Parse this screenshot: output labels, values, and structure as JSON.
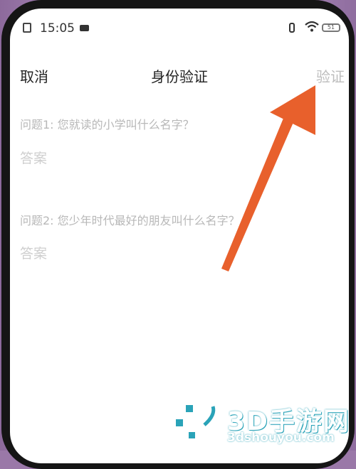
{
  "status_bar": {
    "time": "15:05",
    "battery": "51"
  },
  "navbar": {
    "cancel_label": "取消",
    "title": "身份验证",
    "verify_label": "验证"
  },
  "questions": [
    {
      "prompt": "问题1: 您就读的小学叫什么名字？",
      "answer_placeholder": "答案"
    },
    {
      "prompt": "问题2: 您少年时代最好的朋友叫什么名字？",
      "answer_placeholder": "答案"
    }
  ],
  "watermark": {
    "name": "3D手游网",
    "url": "3dshouyou.com"
  },
  "colors": {
    "arrow": "#e8602c",
    "backdrop": "#9a78a8",
    "placeholder_text": "#cfcfcf",
    "disabled_action": "#bdbdbd"
  }
}
